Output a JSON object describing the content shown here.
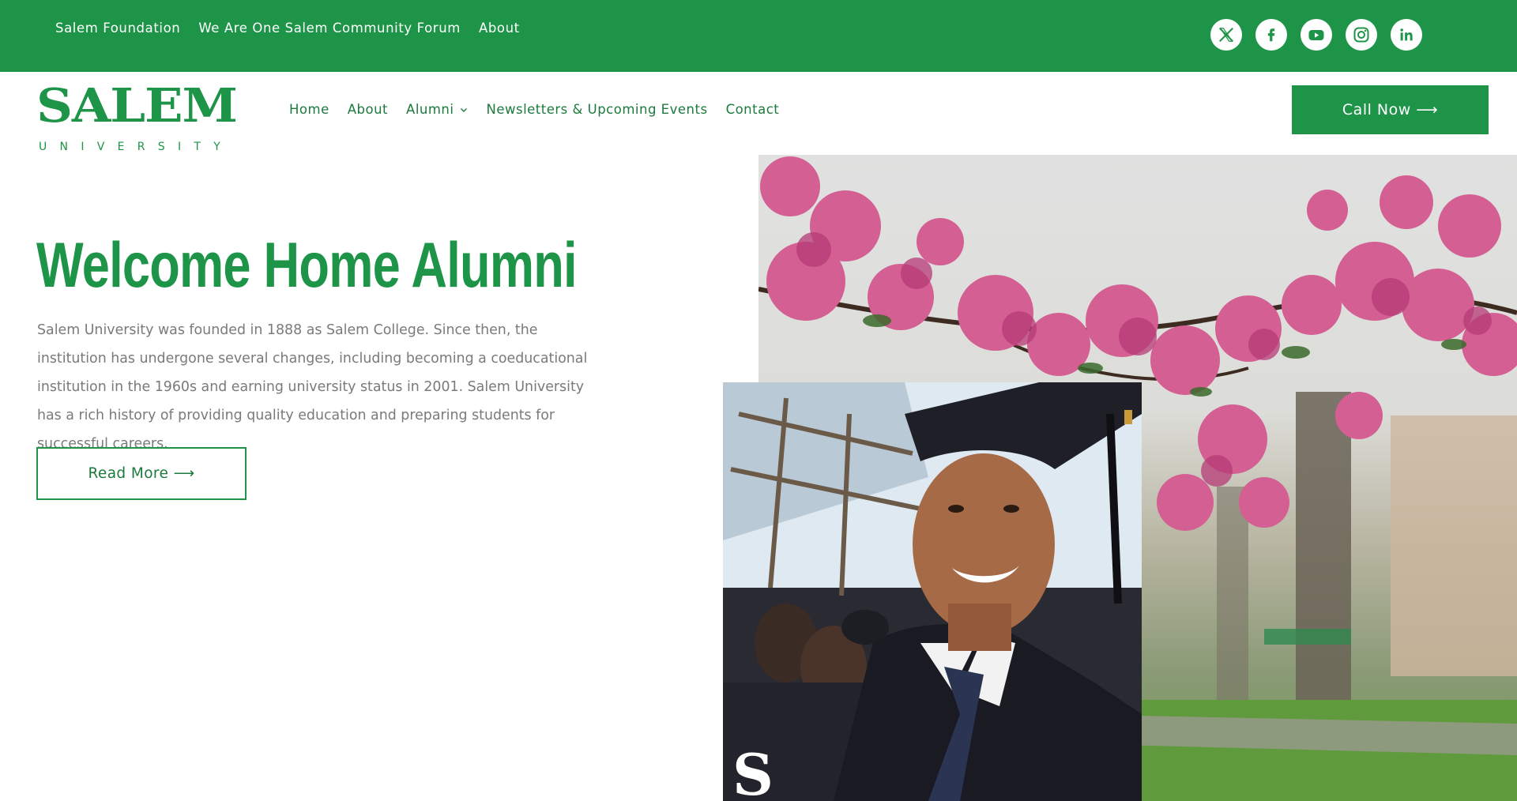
{
  "topbar": {
    "links": [
      "Salem Foundation",
      "We Are One Salem Community Forum",
      "About"
    ],
    "social_icons": [
      "x-icon",
      "facebook-icon",
      "youtube-icon",
      "instagram-icon",
      "linkedin-icon"
    ]
  },
  "logo": {
    "wordmark": "SALEM",
    "subtitle": "UNIVERSITY"
  },
  "nav": {
    "home": "Home",
    "about": "About",
    "alumni": "Alumni",
    "newsletters": "Newsletters & Upcoming Events",
    "contact": "Contact",
    "call_button": "Call Now ⟶"
  },
  "hero": {
    "title": "Welcome Home Alumni",
    "body": "Salem University was founded in 1888 as Salem College. Since then, the institution has undergone several changes, including becoming a coeducational institution in the 1960s and earning university status in 2001. Salem University has a rich history of providing quality education and preparing students for successful careers.",
    "read_more": "Read More ⟶"
  },
  "colors": {
    "brand_green": "#1d9447",
    "nav_text": "#1b7a3c",
    "body_text": "#7a7a7a"
  }
}
